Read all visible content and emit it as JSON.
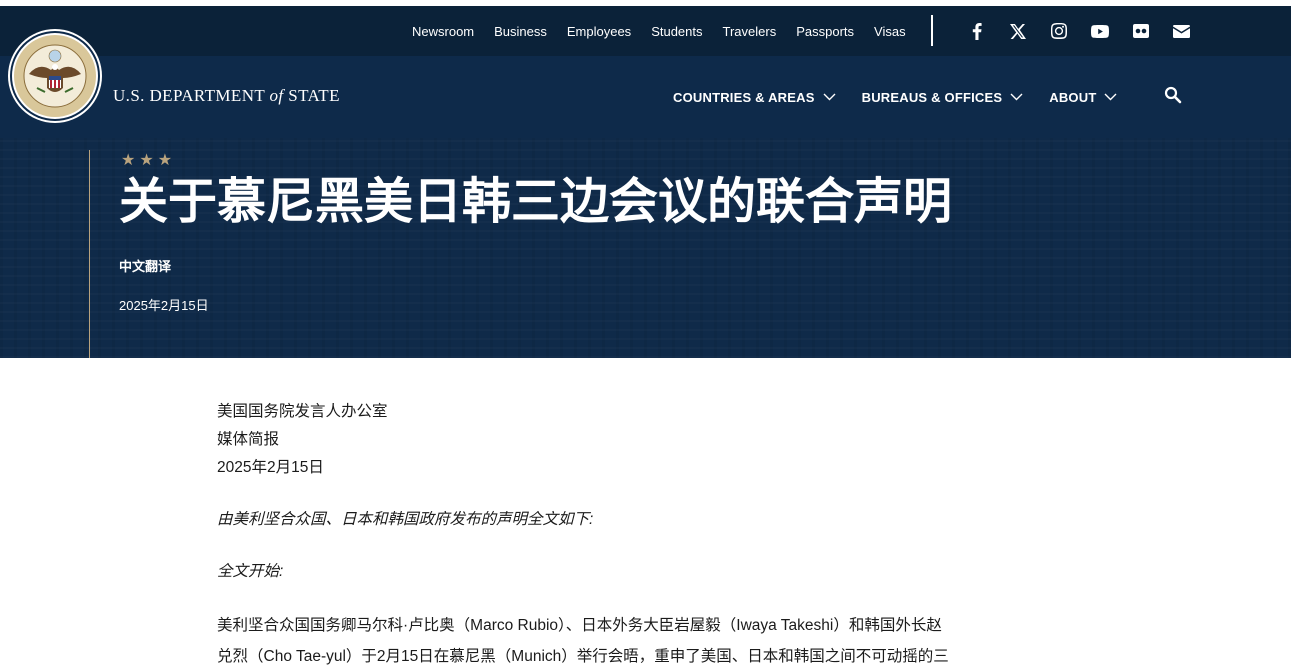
{
  "utility_nav": {
    "links": [
      "Newsroom",
      "Business",
      "Employees",
      "Students",
      "Travelers",
      "Passports",
      "Visas"
    ],
    "social": [
      "facebook-icon",
      "x-icon",
      "instagram-icon",
      "youtube-icon",
      "flickr-icon",
      "email-icon"
    ]
  },
  "brand": {
    "name_pre": "U.S. DEPARTMENT ",
    "name_of": "of",
    "name_post": " STATE"
  },
  "main_nav": {
    "items": [
      "COUNTRIES & AREAS",
      "BUREAUS & OFFICES",
      "ABOUT"
    ]
  },
  "hero": {
    "stars": "★★★",
    "title": "关于慕尼黑美日韩三边会议的联合声明",
    "subtitle": "中文翻译",
    "date": "2025年2月15日"
  },
  "article": {
    "office": "美国国务院发言人办公室",
    "type": "媒体简报",
    "date": "2025年2月15日",
    "intro": "由美利坚合众国、日本和韩国政府发布的声明全文如下:",
    "begin": "全文开始:",
    "para_line1": "美利坚合众国国务卿马尔科·卢比奥（Marco Rubio）、日本外务大臣岩屋毅（Iwaya Takeshi）和韩国外长赵",
    "para_line2": "兑烈（Cho Tae-yul）于2月15日在慕尼黑（Munich）举行会晤，重申了美国、日本和韩国之间不可动摇的三"
  },
  "colors": {
    "utility_bg": "#0b2239",
    "header_bg": "#0e2a4a",
    "accent_gold": "#b9a37e"
  }
}
